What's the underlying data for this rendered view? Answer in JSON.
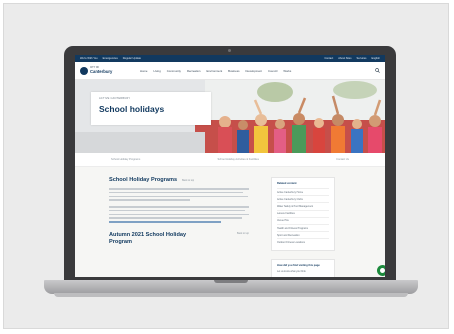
{
  "site": {
    "topbar": {
      "left_links": [
        "We're With You",
        "Emergencies",
        "Regular Update"
      ],
      "right_links": [
        "Contact",
        "About Sites",
        "Services"
      ],
      "language": "English"
    },
    "logo": {
      "small_text": "CITY OF",
      "name": "Canterbury"
    },
    "nav_items": [
      "Home",
      "Living",
      "Community",
      "Recreation",
      "Environment",
      "Business",
      "Development",
      "Council",
      "Works"
    ],
    "hero": {
      "eyebrow": "ACTIVE CANTERBURY",
      "title": "School holidays"
    },
    "subnav": [
      "School Holiday Programs",
      "School Holiday Activities & Facilities",
      "Contact Us"
    ],
    "main": {
      "heading": "School Holiday Programs",
      "heading_meta": "Back to top",
      "second_heading": "Autumn 2021 School Holiday Program",
      "second_meta": "Back to top"
    },
    "sidebar": {
      "heading": "Related content",
      "links": [
        "Active Canterbury Home",
        "Active Canterbury Clubs",
        "Water Safety & Pool Management",
        "Leisure Facilities",
        "Venue Hire",
        "Health and Fitness Programs",
        "Sport and Recreation",
        "Outdoor Fitness Locations"
      ],
      "help_heading": "How did you find visiting this page",
      "help_text": "Let us know what you think"
    }
  },
  "colors": {
    "navy": "#11395f",
    "accent_green": "#1c8a3c"
  }
}
